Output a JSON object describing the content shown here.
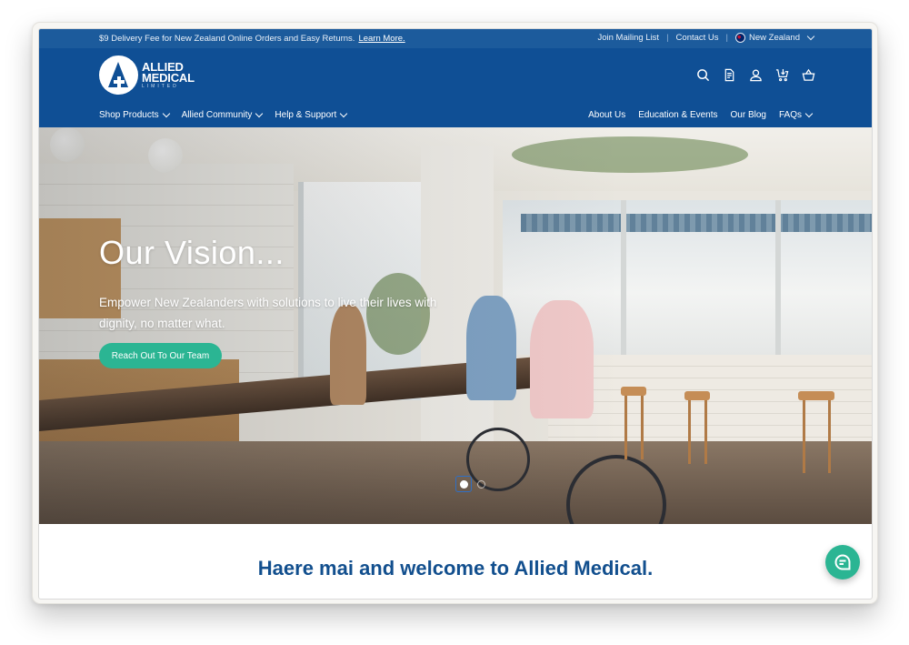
{
  "promo": {
    "text": "$9 Delivery Fee for New Zealand Online Orders and Easy Returns.",
    "link": "Learn More."
  },
  "utility": {
    "links": [
      "Join Mailing List",
      "Contact Us"
    ],
    "separator": "|",
    "country": "New Zealand",
    "country_icon": "nz-flag-icon"
  },
  "brand": {
    "line1": "ALLIED",
    "line2": "MEDICAL",
    "line3": "LIMITED"
  },
  "header_icons": [
    "search-icon",
    "quote-document-icon",
    "account-icon",
    "quick-order-cart-icon",
    "basket-icon"
  ],
  "nav": {
    "left": [
      {
        "label": "Shop Products",
        "dropdown": true
      },
      {
        "label": "Allied Community",
        "dropdown": true
      },
      {
        "label": "Help & Support",
        "dropdown": true
      }
    ],
    "right": [
      {
        "label": "About Us",
        "dropdown": false
      },
      {
        "label": "Education & Events",
        "dropdown": false
      },
      {
        "label": "Our Blog",
        "dropdown": false
      },
      {
        "label": "FAQs",
        "dropdown": true
      }
    ]
  },
  "hero": {
    "title": "Our Vision...",
    "subtitle": "Empower New Zealanders with solutions to live their lives with dignity, no matter what.",
    "cta": "Reach Out To Our Team",
    "slides": 2,
    "active_slide": 1
  },
  "welcome": {
    "heading": "Haere mai and welcome to Allied Medical."
  },
  "colors": {
    "promo_bar": "#1c5b9c",
    "header": "#0f4f95",
    "accent_green": "#2bb593",
    "heading_blue": "#124f8e"
  },
  "chat": {
    "icon": "chat-bubble-icon"
  }
}
